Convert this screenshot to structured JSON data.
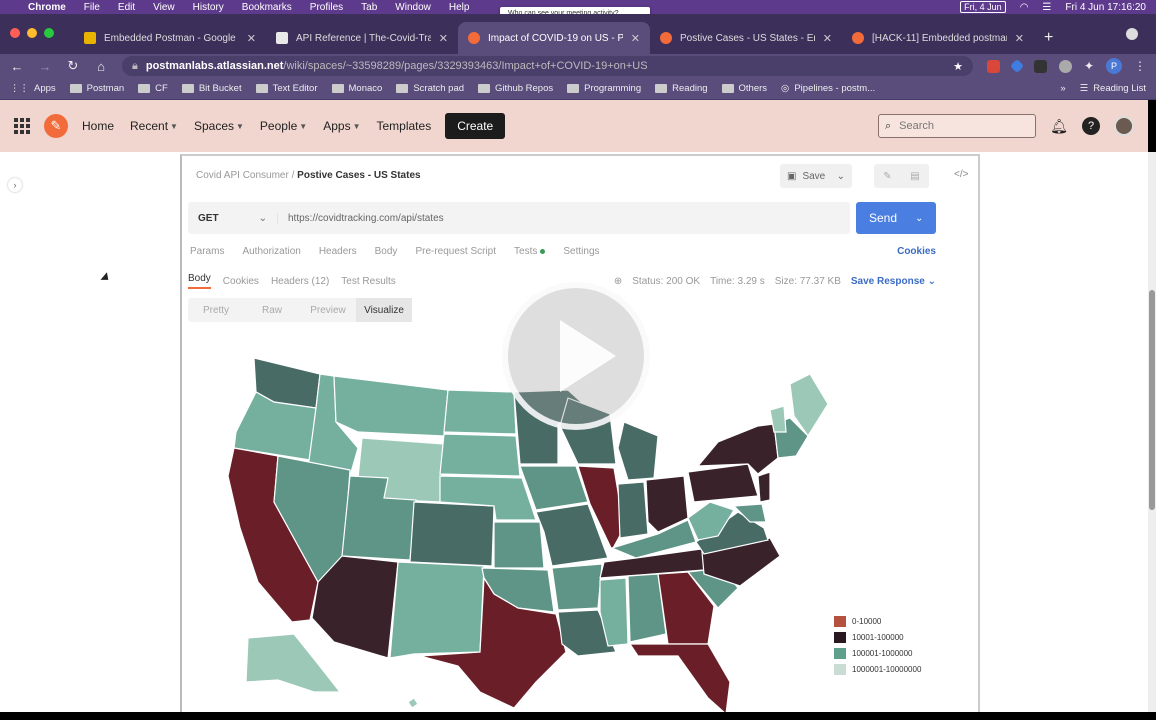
{
  "menubar": {
    "app": "Chrome",
    "menus": [
      "File",
      "Edit",
      "View",
      "History",
      "Bookmarks",
      "Profiles",
      "Tab",
      "Window",
      "Help"
    ],
    "date_badge": "Fri, 4 Jun",
    "clock": "Fri 4 Jun  17:16:20",
    "popup_text": "Who can see your meeting activity?"
  },
  "tabs": [
    {
      "title": "Embedded Postman - Google",
      "favicon_color": "#e8b400"
    },
    {
      "title": "API Reference | The-Covid-Tra",
      "favicon_color": "#e9e9e9"
    },
    {
      "title": "Impact of COVID-19 on US - P",
      "favicon_color": "#f26b3a",
      "active": true
    },
    {
      "title": "Postive Cases - US States - Em",
      "favicon_color": "#f26b3a"
    },
    {
      "title": "[HACK-11] Embedded postman",
      "favicon_color": "#f26b3a"
    }
  ],
  "address": {
    "host": "postmanlabs.atlassian.net",
    "path": "/wiki/spaces/~33598289/pages/3329393463/Impact+of+COVID-19+on+US"
  },
  "bookmarks": {
    "items": [
      "Apps",
      "Postman",
      "CF",
      "Bit Bucket",
      "Text Editor",
      "Monaco",
      "Scratch pad",
      "Github Repos",
      "Programming",
      "Reading",
      "Others",
      "Pipelines - postm..."
    ],
    "reading_list": "Reading List"
  },
  "confluence": {
    "nav": [
      {
        "label": "Home",
        "dropdown": false
      },
      {
        "label": "Recent",
        "dropdown": true
      },
      {
        "label": "Spaces",
        "dropdown": true
      },
      {
        "label": "People",
        "dropdown": true
      },
      {
        "label": "Apps",
        "dropdown": true
      },
      {
        "label": "Templates",
        "dropdown": false
      }
    ],
    "create_label": "Create",
    "search_placeholder": "Search"
  },
  "postman": {
    "breadcrumb_parent": "Covid API Consumer",
    "breadcrumb_current": "Postive Cases - US States",
    "save_label": "Save",
    "method": "GET",
    "url": "https://covidtracking.com/api/states",
    "send_label": "Send",
    "request_tabs": [
      "Params",
      "Authorization",
      "Headers",
      "Body",
      "Pre-request Script",
      "Tests",
      "Settings"
    ],
    "cookies_link": "Cookies",
    "response_tabs": [
      "Body",
      "Cookies",
      "Headers (12)",
      "Test Results"
    ],
    "status": "Status: 200 OK",
    "time": "Time: 3.29 s",
    "size": "Size: 77.37 KB",
    "save_response": "Save Response",
    "view_tabs": [
      "Pretty",
      "Raw",
      "Preview",
      "Visualize"
    ],
    "active_view": "Visualize"
  },
  "legend": [
    {
      "label": "0-10000",
      "color": "#b5523f"
    },
    {
      "label": "10001-100000",
      "color": "#2a1820"
    },
    {
      "label": "100001-1000000",
      "color": "#5fa08c"
    },
    {
      "label": "1000001-10000000",
      "color": "#c9ddd5"
    }
  ],
  "map_colors": {
    "dark_red": "#6a1f28",
    "dark_brown": "#3a222a",
    "dark_teal": "#486b66",
    "mid_teal": "#5e9586",
    "light_teal": "#75b09f",
    "pale_teal": "#9cc8b8"
  }
}
